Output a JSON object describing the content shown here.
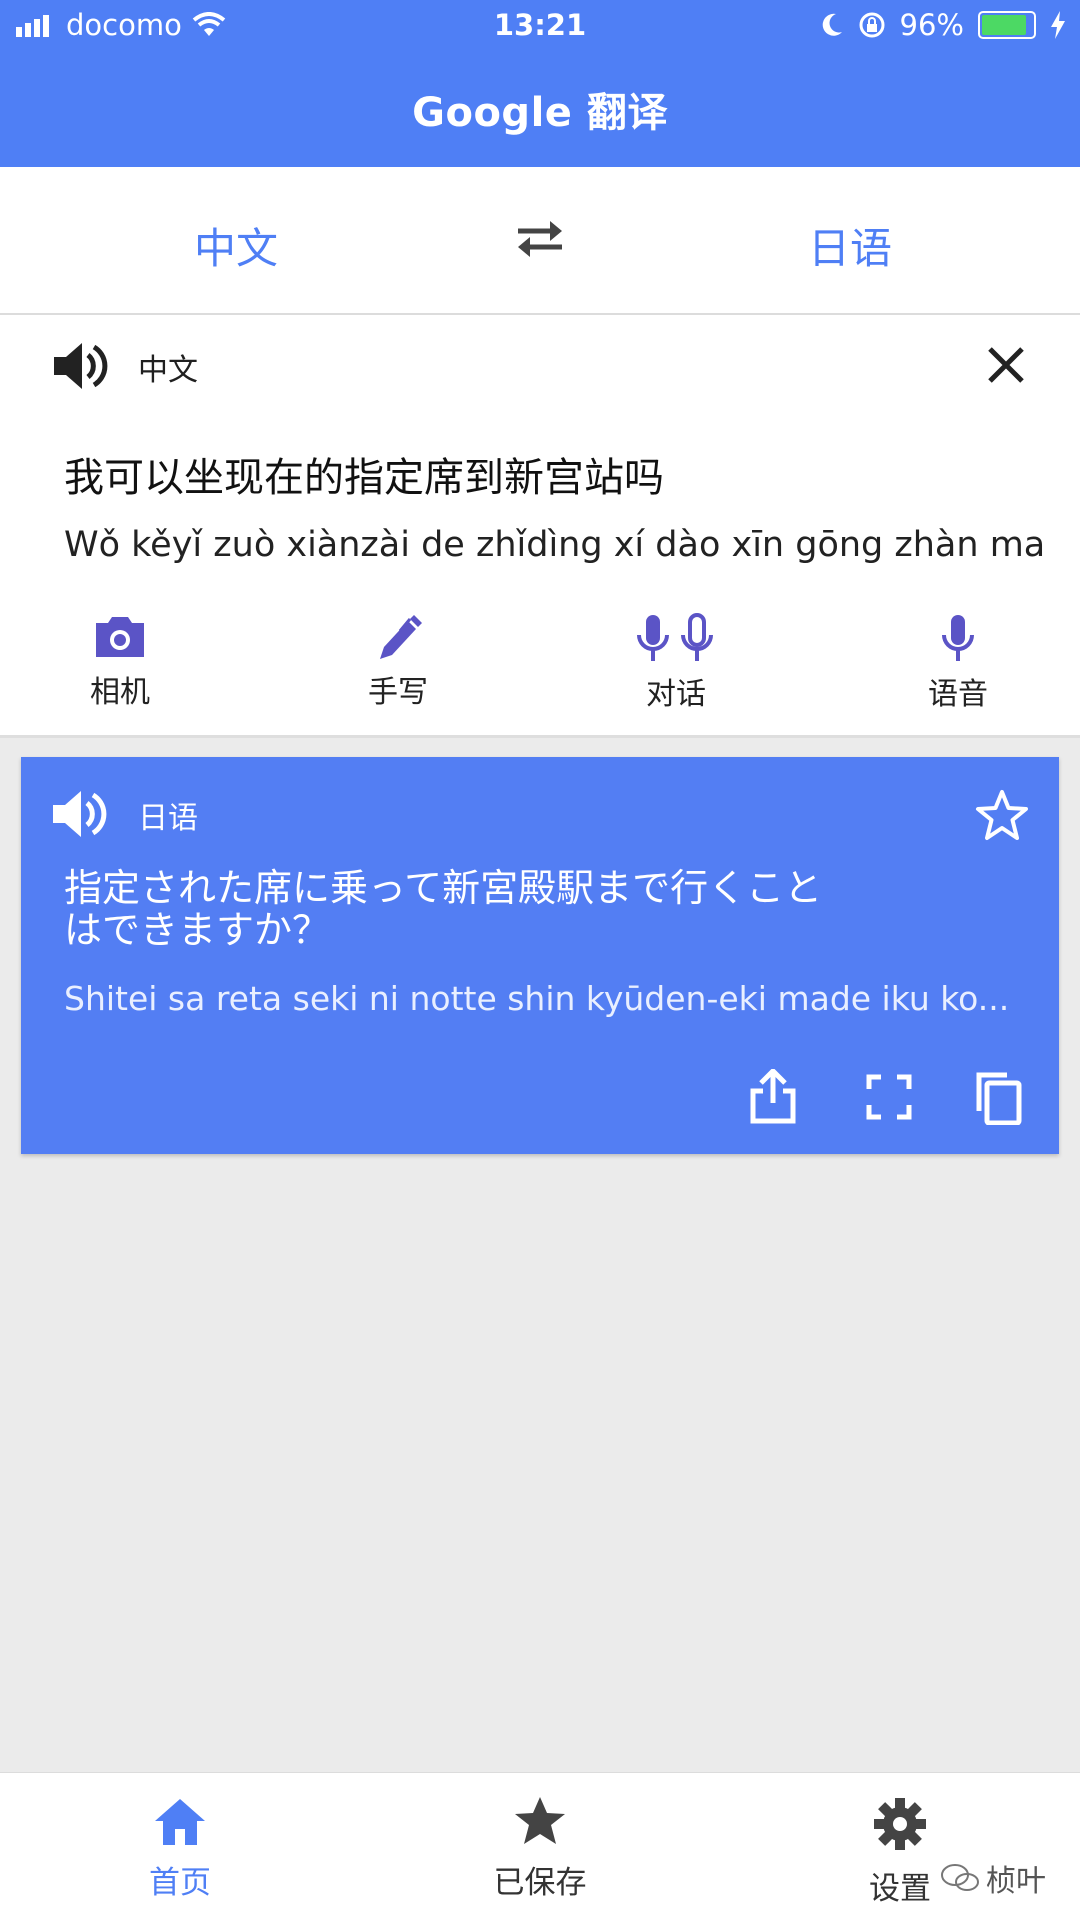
{
  "status_bar": {
    "carrier": "docomo",
    "time": "13:21",
    "battery": "96%",
    "battery_fraction": 0.96
  },
  "header": {
    "title": "Google 翻译"
  },
  "languages": {
    "source": "中文",
    "target": "日语"
  },
  "input": {
    "lang_label": "中文",
    "text": "我可以坐现在的指定席到新宫站吗",
    "romanization": "Wǒ kěyǐ zuò xiànzài de zhǐdìng xí dào xīn gōng zhàn ma"
  },
  "tools": [
    {
      "label": "相机",
      "icon": "camera-icon"
    },
    {
      "label": "手写",
      "icon": "pen-icon"
    },
    {
      "label": "对话",
      "icon": "dual-mic-icon"
    },
    {
      "label": "语音",
      "icon": "mic-icon"
    }
  ],
  "result": {
    "lang_label": "日语",
    "text": "指定された席に乗って新宮殿駅まで行くことはできますか？",
    "romanization": "Shitei sa reta seki ni notte shin kyūden-eki made iku ko..."
  },
  "bottom_nav": [
    {
      "label": "首页",
      "icon": "home-icon",
      "active": true
    },
    {
      "label": "已保存",
      "icon": "star-icon",
      "active": false
    },
    {
      "label": "设置",
      "icon": "gear-icon",
      "active": false
    }
  ],
  "watermark": "桢叶",
  "colors": {
    "primary": "#4f7ff5",
    "card_blue": "#537ef3",
    "tool_purple": "#5b54c6"
  }
}
